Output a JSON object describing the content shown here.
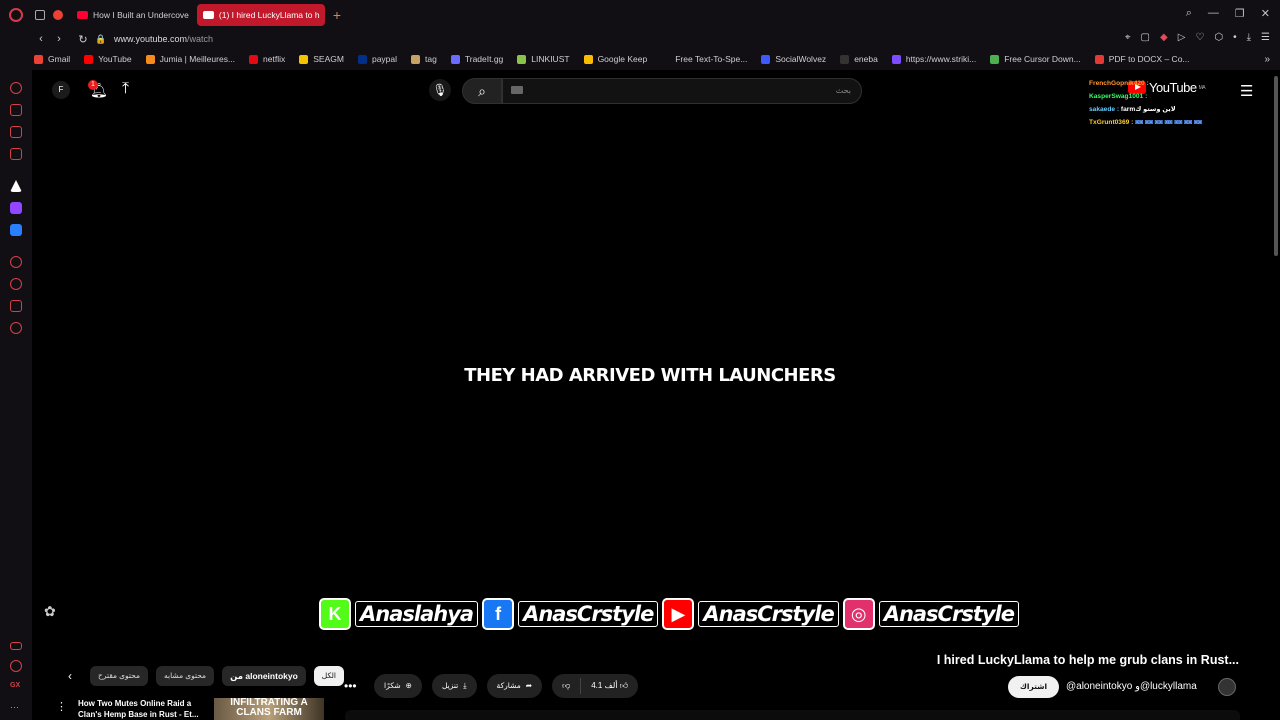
{
  "browser": {
    "tabs": [
      {
        "title": "How I Built an Undercove",
        "active": false
      },
      {
        "title": "(1) I hired LuckyLlama to h",
        "active": true
      }
    ],
    "new_tab": "+",
    "url_host": "www.youtube.com",
    "url_path": "/watch",
    "window_controls": [
      "⌕",
      "—",
      "❐",
      "✕"
    ]
  },
  "bookmarks": [
    {
      "label": "Gmail",
      "color": "#ea4335"
    },
    {
      "label": "YouTube",
      "color": "#ff0000"
    },
    {
      "label": "Jumia | Meilleures...",
      "color": "#f68b1e"
    },
    {
      "label": "netflix",
      "color": "#e50914"
    },
    {
      "label": "SEAGM",
      "color": "#f5c400"
    },
    {
      "label": "paypal",
      "color": "#003087"
    },
    {
      "label": "tag",
      "color": "#c8a165"
    },
    {
      "label": "TradeIt.gg",
      "color": "#6b6bff"
    },
    {
      "label": "LINKIUST",
      "color": "#8bc34a"
    },
    {
      "label": "Google Keep",
      "color": "#fbbc04"
    },
    {
      "label": "Free Text-To-Spe...",
      "color": "#110f14"
    },
    {
      "label": "SocialWolvez",
      "color": "#3d5afe"
    },
    {
      "label": "eneba",
      "color": "#333333"
    },
    {
      "label": "https://www.striki...",
      "color": "#7c4dff"
    },
    {
      "label": "Free Cursor Down...",
      "color": "#4caf50"
    },
    {
      "label": "PDF to DOCX – Co...",
      "color": "#e53935"
    }
  ],
  "youtube": {
    "avatar_letter": "F",
    "notifications_count": "1",
    "search_placeholder": "بحث",
    "logo_text": "YouTube",
    "logo_country": "MA",
    "chat": [
      {
        "user": "FrenchGopnik420 :",
        "msg": ""
      },
      {
        "user": "KasperSwag1001 :",
        "msg": ""
      },
      {
        "user": "sakaede :",
        "msg": "farmلاين وستو ك"
      },
      {
        "user": "TxGrunt0369 :",
        "msg": "◙◙ ◙◙ ◙◙ ◙◙ ◙◙ ◙◙ ◙◙"
      }
    ],
    "video_caption": "THEY HAD ARRIVED WITH LAUNCHERS",
    "socials": [
      {
        "icon": "K",
        "handle": "Anaslahya",
        "color": "#53fc18"
      },
      {
        "icon": "f",
        "handle": "AnasCrstyle",
        "color": "#1877f2"
      },
      {
        "icon": "▶",
        "handle": "AnasCrstyle",
        "color": "#ff0000"
      },
      {
        "icon": "◎",
        "handle": "AnasCrstyle",
        "color": "#e1306c"
      }
    ],
    "video_title": "I hired LuckyLlama to help me grub clans in Rust...",
    "chips": [
      "محتوى مقترح",
      "محتوى مشابه",
      "من aloneintokyo",
      "الكل"
    ],
    "actions": {
      "more": "•••",
      "thanks": "شكرًا",
      "download": "تنزيل",
      "share": "مشاركة",
      "likes": "4.1 ألف"
    },
    "subscribe": "اشتراك",
    "channel": "@aloneintokyo و@luckyllama",
    "recommended": {
      "title": "How Two Mutes Online Raid a Clan's Hemp Base in Rust - Et...",
      "thumb_text": "INFILTRATING A CLANS FARM"
    }
  }
}
